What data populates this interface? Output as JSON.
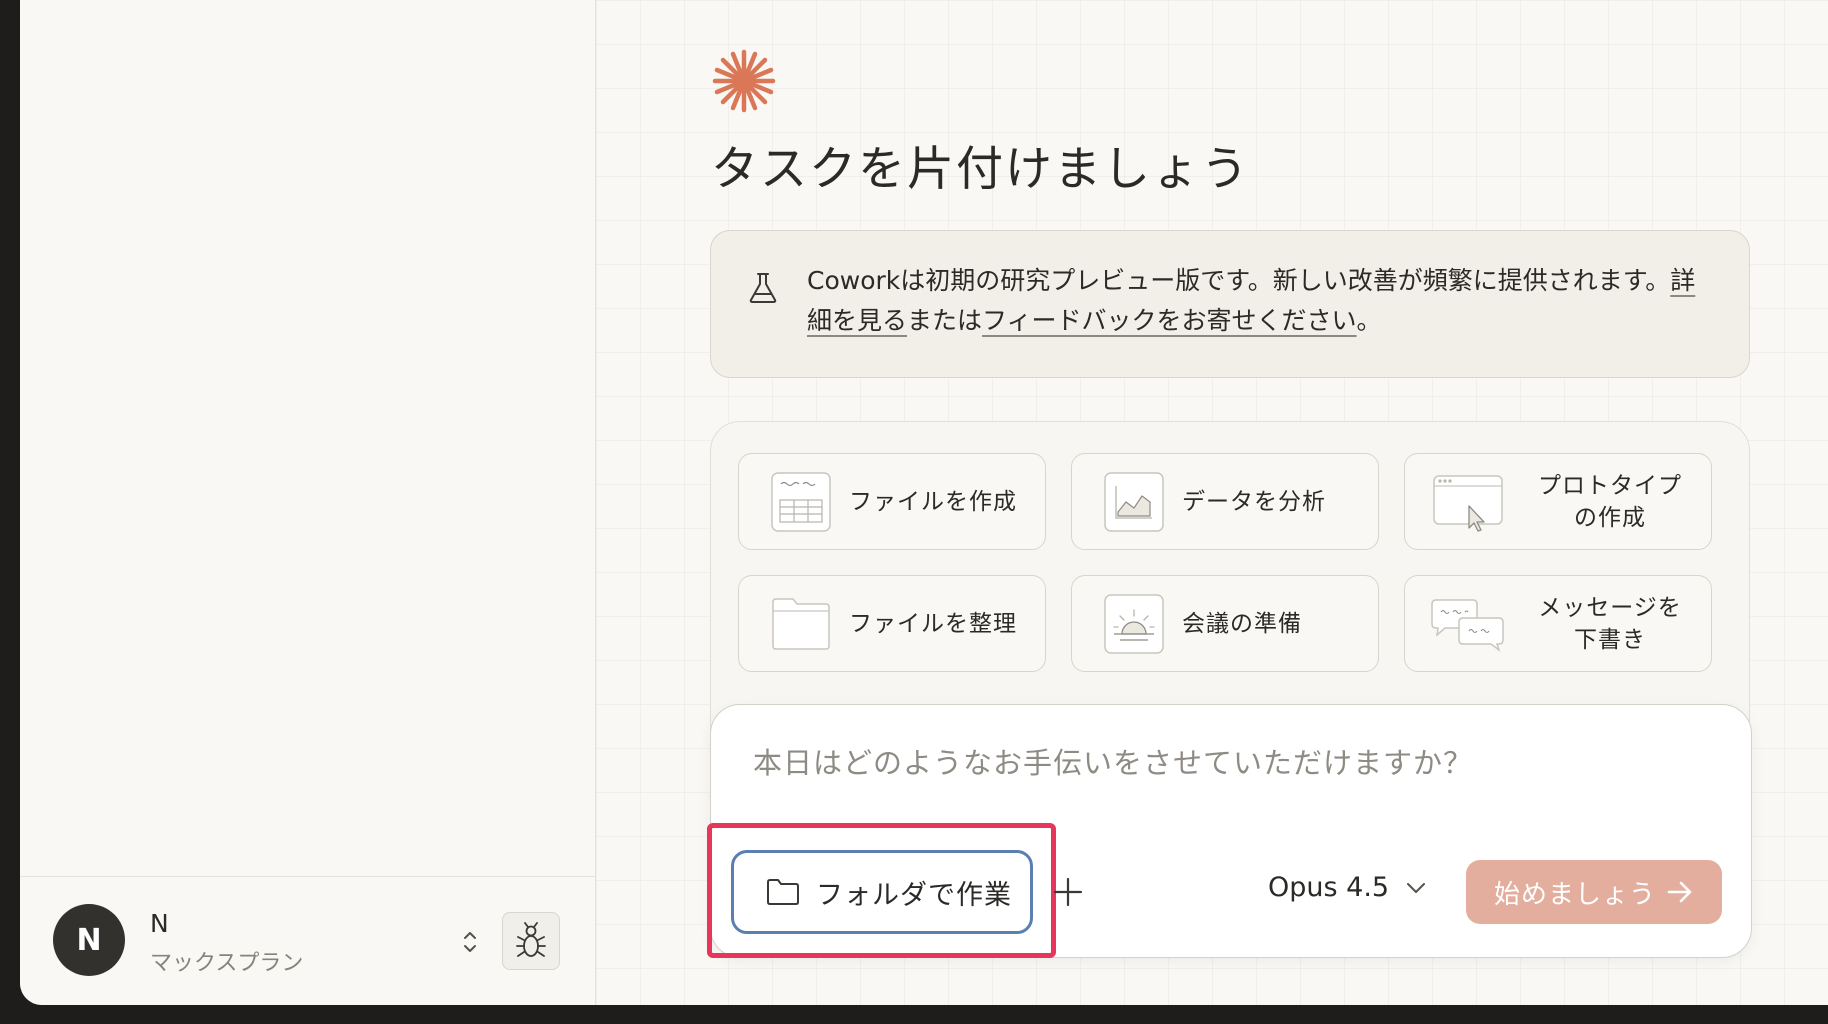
{
  "user": {
    "initial": "N",
    "name": "N",
    "plan": "マックスプラン"
  },
  "main": {
    "title": "タスクを片付けましょう"
  },
  "notice": {
    "text_1": "Coworkは初期の研究プレビュー版です。新しい改善が頻繁に提供されます。",
    "link_1": "詳細を見る",
    "text_2": "または",
    "link_2": "フィードバックをお寄せください",
    "text_3": "。"
  },
  "tasks": [
    {
      "label": "ファイルを作成",
      "icon": "spreadsheet-icon"
    },
    {
      "label": "データを分析",
      "icon": "chart-icon"
    },
    {
      "label": "プロトタイプの作成",
      "icon": "browser-cursor-icon"
    },
    {
      "label": "ファイルを整理",
      "icon": "folder-icon"
    },
    {
      "label": "会議の準備",
      "icon": "sunrise-icon"
    },
    {
      "label": "メッセージを下書き",
      "icon": "chat-bubbles-icon"
    }
  ],
  "composer": {
    "placeholder": "本日はどのようなお手伝いをさせていただけますか？",
    "folder_button": "フォルダで作業",
    "model": "Opus 4.5",
    "start_button": "始めましょう"
  },
  "colors": {
    "accent": "#d97757",
    "start_button": "#e3ae9d",
    "highlight": "#e8355c",
    "folder_border": "#5a7fb0"
  }
}
